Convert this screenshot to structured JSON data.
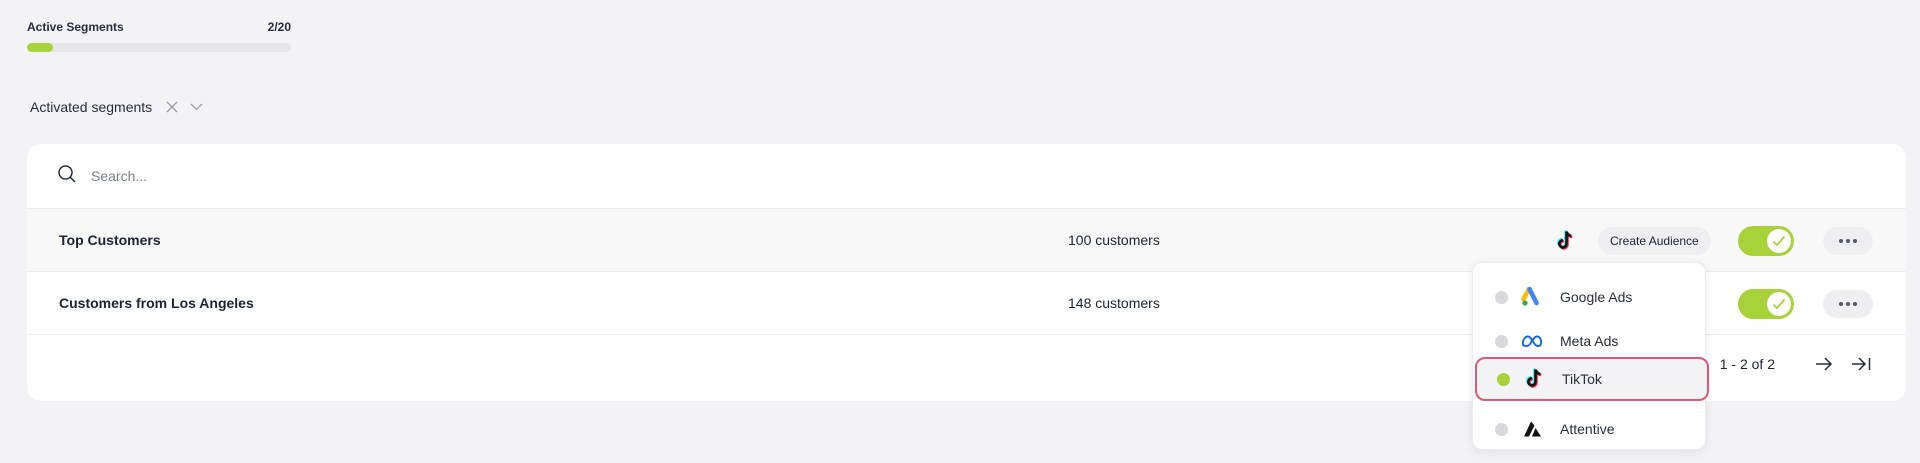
{
  "quota": {
    "label": "Active Segments",
    "value": "2/20",
    "fraction": 0.1
  },
  "filter": {
    "label": "Activated segments"
  },
  "search": {
    "placeholder": "Search..."
  },
  "segments": [
    {
      "name": "Top Customers",
      "count": "100 customers",
      "create_label": "Create Audience",
      "active": true
    },
    {
      "name": "Customers from Los Angeles",
      "count": "148 customers",
      "active": true
    }
  ],
  "pagination": {
    "range": "1 - 2 of 2"
  },
  "destination_menu": {
    "items": [
      {
        "label": "Google Ads",
        "icon": "google-ads-logo",
        "selected": false
      },
      {
        "label": "Meta Ads",
        "icon": "meta-logo",
        "selected": false
      },
      {
        "label": "TikTok",
        "icon": "tiktok-logo",
        "selected": true
      },
      {
        "label": "Attentive",
        "icon": "attentive-logo",
        "selected": false
      }
    ]
  },
  "colors": {
    "accent": "#a8d23a",
    "highlight": "#e0577a",
    "background": "#f3f3f5"
  }
}
